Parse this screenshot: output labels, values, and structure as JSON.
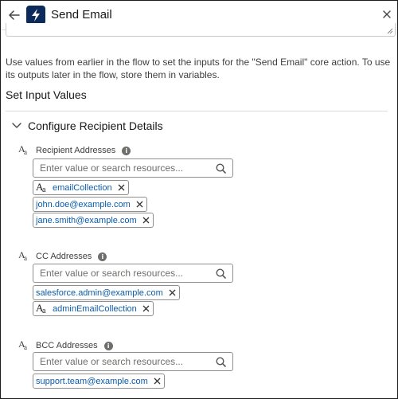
{
  "header": {
    "title": "Send Email",
    "back_icon": "arrow-left-icon",
    "app_icon": "lightning-bolt-icon",
    "close_icon": "close-icon",
    "app_icon_color": "#0c2a5a"
  },
  "description": "Use values from earlier in the flow to set the inputs for the \"Send Email\" core action. To use its outputs later in the flow, store them in variables.",
  "section_title": "Set Input Values",
  "group": {
    "label": "Configure Recipient Details",
    "expanded": true
  },
  "fields": {
    "recipient": {
      "label": "Recipient Addresses",
      "placeholder": "Enter value or search resources...",
      "pills": [
        {
          "text": "emailCollection",
          "is_resource": true
        },
        {
          "text": "john.doe@example.com",
          "is_resource": false
        },
        {
          "text": "jane.smith@example.com",
          "is_resource": false
        }
      ]
    },
    "cc": {
      "label": "CC Addresses",
      "placeholder": "Enter value or search resources...",
      "pills": [
        {
          "text": "salesforce.admin@example.com",
          "is_resource": false
        },
        {
          "text": "adminEmailCollection",
          "is_resource": true
        }
      ]
    },
    "bcc": {
      "label": "BCC Addresses",
      "placeholder": "Enter value or search resources...",
      "pills": [
        {
          "text": "support.team@example.com",
          "is_resource": false
        }
      ]
    }
  },
  "type_icon_text": {
    "big": "A",
    "small": "a"
  },
  "info_icon_text": "i",
  "colors": {
    "pill_text": "#0b5cab",
    "label_text": "#3e3e3c",
    "border": "#8e8e8e"
  }
}
